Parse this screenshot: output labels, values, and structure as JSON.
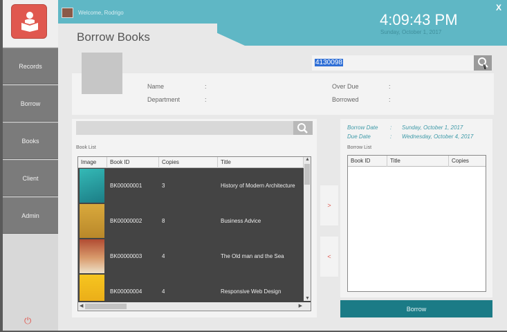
{
  "header": {
    "welcome": "Welcome, Rodrigo",
    "page_title": "Borrow Books",
    "time": "4:09:43 PM",
    "date": "Sunday, October 1, 2017",
    "close": "X"
  },
  "sidebar": {
    "items": [
      {
        "label": "Records"
      },
      {
        "label": "Borrow"
      },
      {
        "label": "Books"
      },
      {
        "label": "Client"
      },
      {
        "label": "Admin"
      }
    ]
  },
  "client": {
    "search_value": "4130098",
    "name_label": "Name",
    "department_label": "Department",
    "overdue_label": "Over Due",
    "borrowed_label": "Borrowed",
    "colon": ":"
  },
  "book_list": {
    "title": "Book List",
    "columns": [
      "Image",
      "Book ID",
      "Copies",
      "Title"
    ],
    "rows": [
      {
        "id": "BK00000001",
        "copies": "3",
        "title": "History of Modern Architecture",
        "cover_color": "#2aa3a8"
      },
      {
        "id": "BK00000002",
        "copies": "8",
        "title": "Business Advice",
        "cover_color": "#d1a33a"
      },
      {
        "id": "BK00000003",
        "copies": "4",
        "title": "The Old man and the Sea",
        "cover_color": "#b55a3c"
      },
      {
        "id": "BK00000004",
        "copies": "4",
        "title": "Responsive Web Design",
        "cover_color": "#f2c11d"
      }
    ]
  },
  "buttons": {
    "add": ">",
    "remove": "<",
    "borrow": "Borrow"
  },
  "borrow": {
    "borrow_date_label": "Borrow Date",
    "borrow_date": "Sunday, October 1, 2017",
    "due_date_label": "Due Date",
    "due_date": "Wednesday, October 4, 2017",
    "list_title": "Borrow List",
    "columns": [
      "Book ID",
      "Title",
      "Copies"
    ]
  },
  "colors": {
    "accent": "#5fb7c5",
    "brand_red": "#e0584f",
    "borrow_button": "#1b7b86"
  }
}
